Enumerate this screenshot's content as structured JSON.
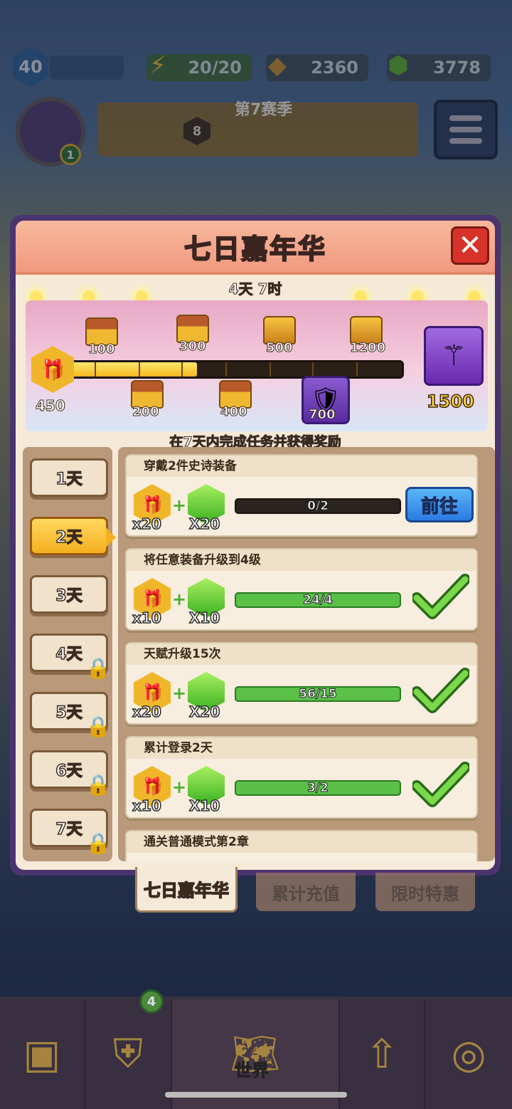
{
  "hud": {
    "level": "40",
    "energy": "20/20",
    "currency_a": "2360",
    "currency_b": "3778",
    "avatar_badge": "1",
    "season_title": "第7赛季",
    "season_level": "8"
  },
  "panel": {
    "title": "七日嘉年华",
    "close": "✕",
    "timer": "4天 7时",
    "points": "450",
    "milestones_top": [
      "100",
      "300",
      "500",
      "1200"
    ],
    "milestones_bottom": [
      "200",
      "400",
      "700"
    ],
    "final_reward": "1500",
    "progress_fraction": 0.4,
    "description": "在7天内完成任务并获得奖励"
  },
  "days": [
    {
      "label": "1天",
      "locked": false,
      "active": false
    },
    {
      "label": "2天",
      "locked": false,
      "active": true
    },
    {
      "label": "3天",
      "locked": false,
      "active": false
    },
    {
      "label": "4天",
      "locked": true,
      "active": false
    },
    {
      "label": "5天",
      "locked": true,
      "active": false
    },
    {
      "label": "6天",
      "locked": true,
      "active": false
    },
    {
      "label": "7天",
      "locked": true,
      "active": false
    }
  ],
  "tasks": [
    {
      "title": "穿戴2件史诗装备",
      "gift_qty": "x20",
      "gem_qty": "X20",
      "progress": "0/2",
      "done": false,
      "action": "前往"
    },
    {
      "title": "将任意装备升级到4级",
      "gift_qty": "x10",
      "gem_qty": "X10",
      "progress": "24/4",
      "done": true
    },
    {
      "title": "天赋升级15次",
      "gift_qty": "x20",
      "gem_qty": "X20",
      "progress": "56/15",
      "done": true
    },
    {
      "title": "累计登录2天",
      "gift_qty": "x10",
      "gem_qty": "X10",
      "progress": "3/2",
      "done": true
    },
    {
      "title": "通关普通模式第2章"
    }
  ],
  "tabs": [
    "七日嘉年华",
    "累计充值",
    "限时特惠"
  ],
  "nav": {
    "world_label": "世界",
    "equip_badge": "4"
  },
  "colors": {
    "panel_header": "#f19a80",
    "accent_gold": "#f3b020",
    "progress_green": "#5ac048",
    "button_blue": "#2a7ae0"
  }
}
